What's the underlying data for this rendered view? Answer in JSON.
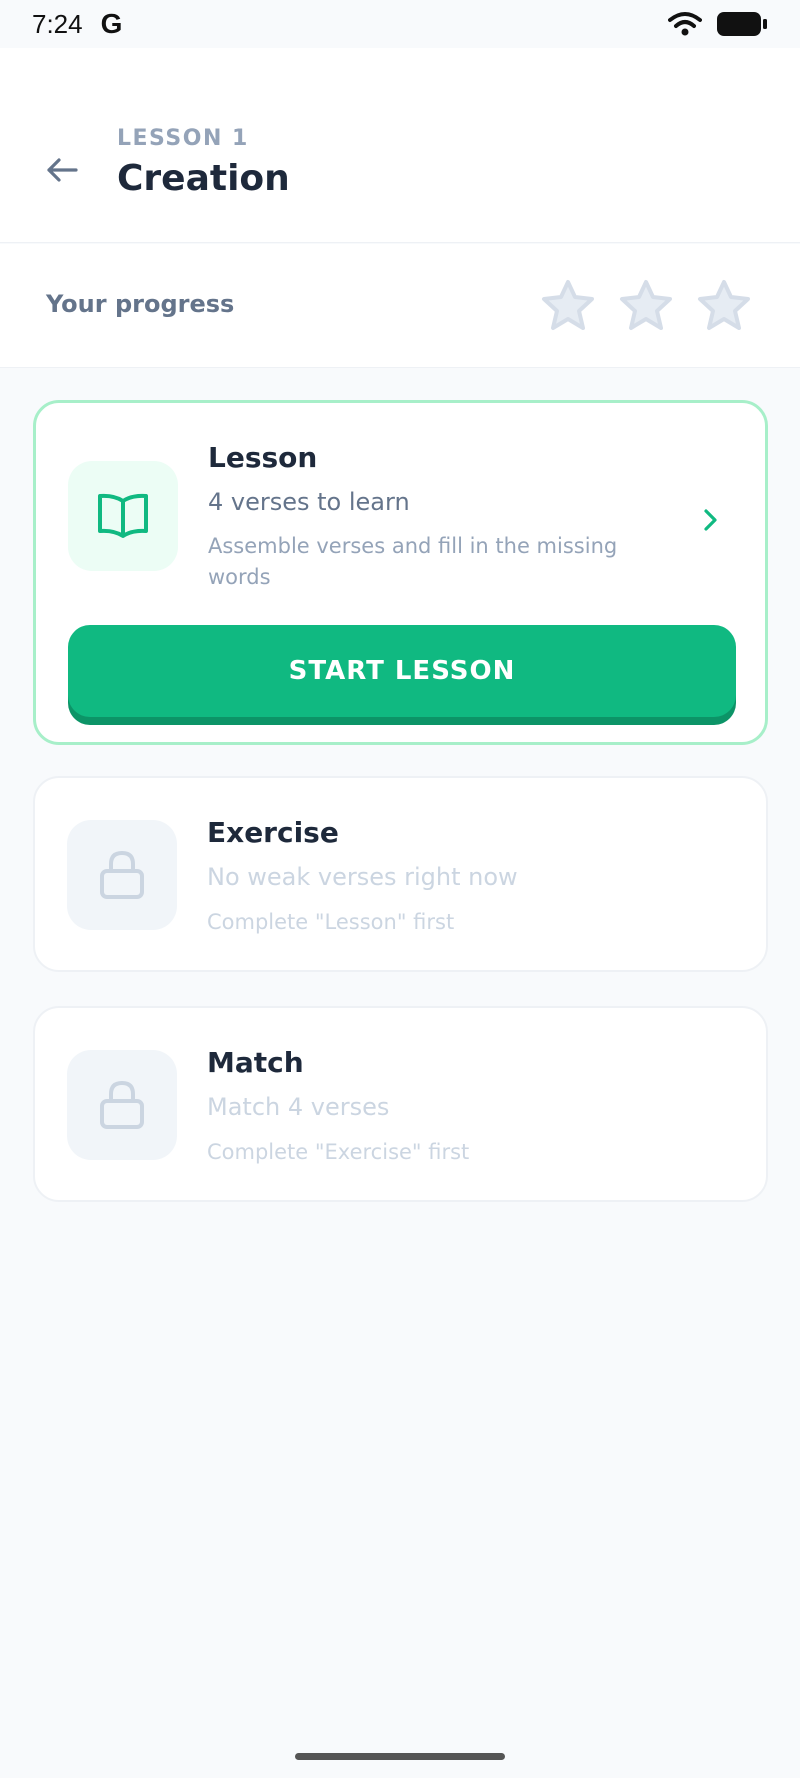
{
  "status": {
    "time": "7:24",
    "provider_glyph": "G"
  },
  "header": {
    "kicker": "LESSON 1",
    "title": "Creation"
  },
  "progress": {
    "label": "Your progress",
    "stars_earned": 0,
    "stars_total": 3
  },
  "cards": {
    "lesson": {
      "title": "Lesson",
      "subtitle": "4 verses to learn",
      "description": "Assemble verses and fill in the missing words",
      "button": "START LESSON",
      "icon": "book-open-icon"
    },
    "exercise": {
      "title": "Exercise",
      "subtitle": "No weak verses right now",
      "description": "Complete \"Lesson\" first",
      "icon": "lock-icon"
    },
    "match": {
      "title": "Match",
      "subtitle": "Match 4 verses",
      "description": "Complete \"Exercise\" first",
      "icon": "lock-icon"
    }
  },
  "colors": {
    "accent": "#10b981",
    "accent_border": "#a7efc9",
    "star_empty": "#d5dde8",
    "locked_icon_bg": "#f1f5f9"
  }
}
